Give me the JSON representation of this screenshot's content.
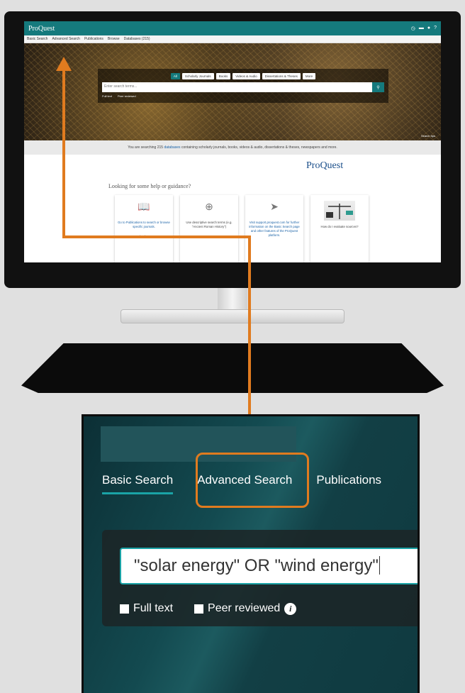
{
  "monitor": {
    "app_title": "ProQuest",
    "nav": [
      "Basic Search",
      "Advanced Search",
      "Publications",
      "Browse",
      "Databases (215)"
    ],
    "search_tabs": [
      "All",
      "Scholarly Journals",
      "Books",
      "Videos & Audio",
      "Dissertations & Theses",
      "More"
    ],
    "search_placeholder": "Enter search terms...",
    "option_full_text": "Full text",
    "option_peer_reviewed": "Peer reviewed",
    "search_tips": "Search tips",
    "status_prefix": "You are searching",
    "status_count": "215",
    "status_link": "databases",
    "status_suffix": "containing scholarly journals, books, videos & audio, dissertations & theses, newspapers and more.",
    "logo": "ProQuest",
    "help_title": "Looking for some help or guidance?",
    "cards": [
      {
        "text": "Go to Publications to search or browse specific journals.",
        "sub": "books"
      },
      {
        "text": "Use descriptive search terms (e.g. \"Ancient Roman History\")",
        "sub": ""
      },
      {
        "text": "Visit support.proquest.com for further information on the Basic Search page and other features of the ProQuest platform.",
        "sub": ""
      },
      {
        "text": "How do I evaluate sources?",
        "sub": ""
      }
    ]
  },
  "zoom": {
    "nav": [
      "Basic Search",
      "Advanced Search",
      "Publications"
    ],
    "search_value": "\"solar energy\" OR \"wind energy\"",
    "full_text": "Full text",
    "peer_reviewed": "Peer reviewed"
  },
  "colors": {
    "teal": "#157a7d",
    "arrow": "#e07b1f"
  }
}
